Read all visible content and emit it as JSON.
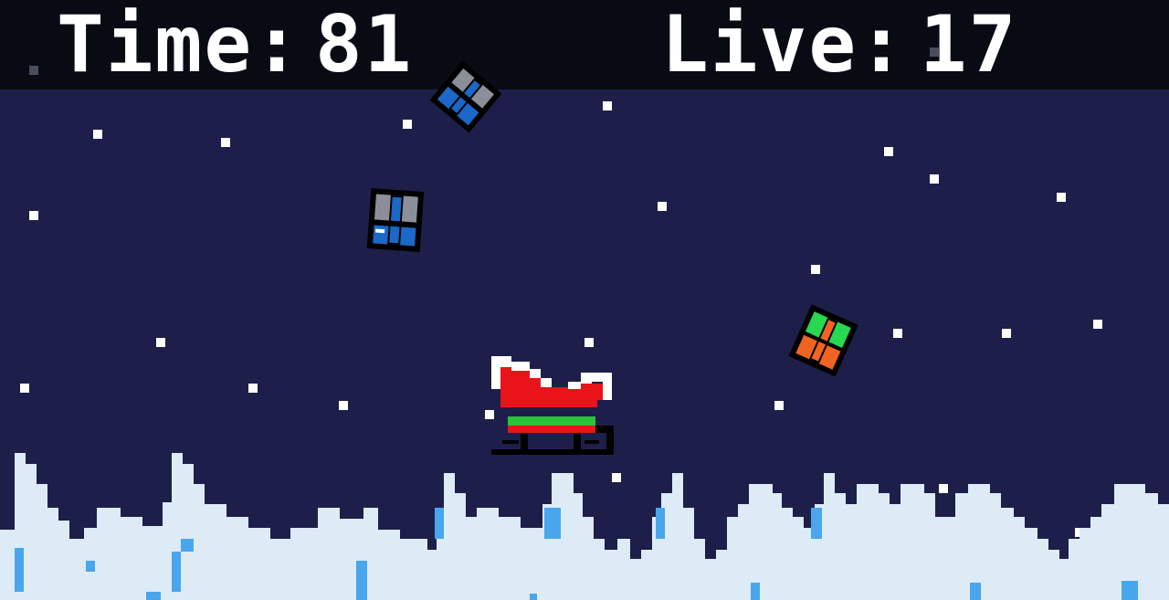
{
  "hud": {
    "time_label": "Time",
    "time_value": "81",
    "lives_label": "Live",
    "lives_value": "17"
  },
  "colors": {
    "night_sky": "#1d1f4a",
    "hud_bar": "#080b14",
    "hud_text": "#ffffff",
    "snow": "#dcebf6",
    "ice_accent": "#4aa6ec",
    "sleigh_red": "#e8141a",
    "sleigh_stripe": "#2cc23a",
    "gift_grey": "#8a8f99",
    "gift_blue": "#1a68c8",
    "gift_green": "#27d850",
    "gift_orange": "#ef6420"
  },
  "sprites": [
    {
      "name": "sleigh",
      "icon": "santa-sleigh"
    },
    {
      "name": "gift",
      "icon": "gift-box",
      "ribbon": "grey",
      "box": "blue"
    },
    {
      "name": "gift",
      "icon": "gift-box",
      "ribbon": "grey",
      "box": "blue"
    },
    {
      "name": "gift",
      "icon": "gift-box",
      "ribbon": "green",
      "box": "orange"
    }
  ]
}
